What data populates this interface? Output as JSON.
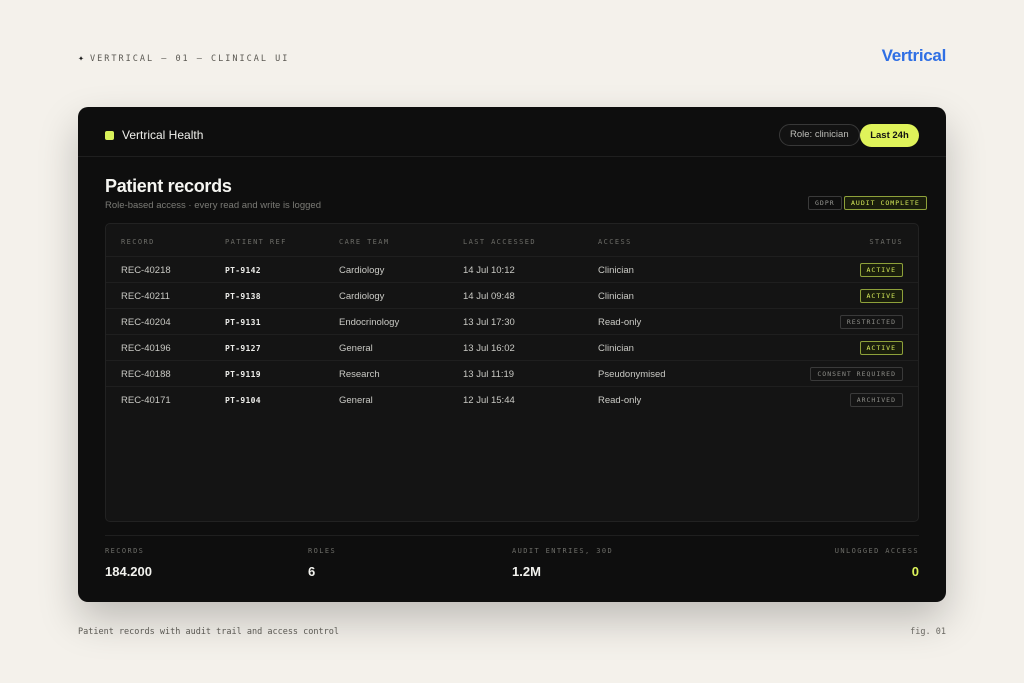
{
  "page": {
    "label": "VERTRICAL — 01 — CLINICAL UI",
    "brand": "Vertrical",
    "caption": "Patient records with audit trail and access control",
    "fig": "fig. 01"
  },
  "app": {
    "name": "Vertrical Health",
    "role_chip": "Role: clinician",
    "time_chip": "Last 24h",
    "title": "Patient records",
    "subtitle": "Role-based access · every read and write is logged",
    "badges": {
      "gdpr": "GDPR",
      "audit": "AUDIT COMPLETE"
    }
  },
  "table": {
    "columns": [
      "RECORD",
      "PATIENT REF",
      "CARE TEAM",
      "LAST ACCESSED",
      "ACCESS",
      "STATUS"
    ],
    "rows": [
      {
        "record": "REC-40218",
        "ref": "PT-9142",
        "team": "Cardiology",
        "accessed": "14 Jul 10:12",
        "access": "Clinician",
        "status": "ACTIVE",
        "active": true
      },
      {
        "record": "REC-40211",
        "ref": "PT-9138",
        "team": "Cardiology",
        "accessed": "14 Jul 09:48",
        "access": "Clinician",
        "status": "ACTIVE",
        "active": true
      },
      {
        "record": "REC-40204",
        "ref": "PT-9131",
        "team": "Endocrinology",
        "accessed": "13 Jul 17:30",
        "access": "Read-only",
        "status": "RESTRICTED",
        "active": false
      },
      {
        "record": "REC-40196",
        "ref": "PT-9127",
        "team": "General",
        "accessed": "13 Jul 16:02",
        "access": "Clinician",
        "status": "ACTIVE",
        "active": true
      },
      {
        "record": "REC-40188",
        "ref": "PT-9119",
        "team": "Research",
        "accessed": "13 Jul 11:19",
        "access": "Pseudonymised",
        "status": "CONSENT REQUIRED",
        "active": false
      },
      {
        "record": "REC-40171",
        "ref": "PT-9104",
        "team": "General",
        "accessed": "12 Jul 15:44",
        "access": "Read-only",
        "status": "ARCHIVED",
        "active": false
      }
    ]
  },
  "stats": [
    {
      "label": "RECORDS",
      "value": "184.200"
    },
    {
      "label": "ROLES",
      "value": "6"
    },
    {
      "label": "AUDIT ENTRIES, 30D",
      "value": "1.2M"
    },
    {
      "label": "UNLOGGED ACCESS",
      "value": "0"
    }
  ],
  "colors": {
    "accent": "#dff35a",
    "brand": "#2f6fe4",
    "card": "#0e0e0e",
    "page": "#f4f1eb"
  }
}
